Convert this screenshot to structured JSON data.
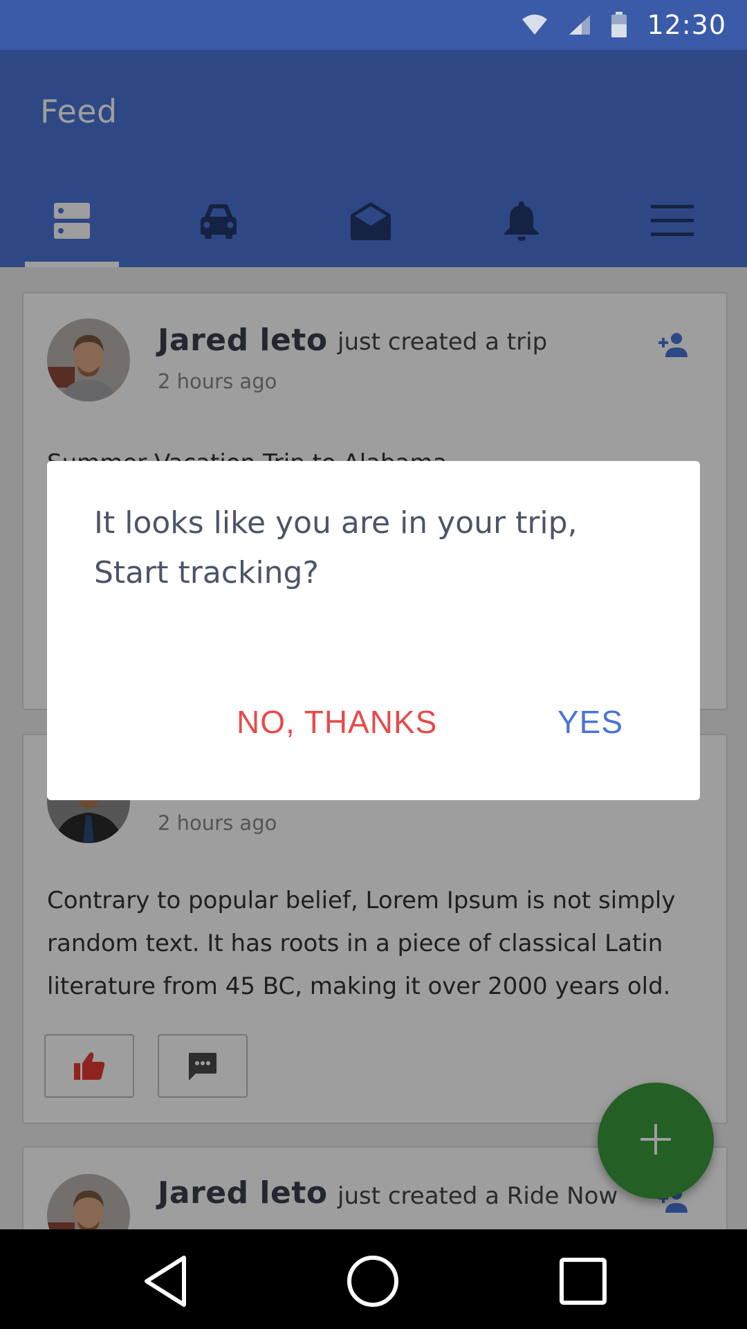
{
  "status_bar": {
    "time": "12:30"
  },
  "app_bar": {
    "title": "Feed",
    "tabs": [
      {
        "name": "feed",
        "icon": "list-icon",
        "active": true
      },
      {
        "name": "rides",
        "icon": "car-icon",
        "active": false
      },
      {
        "name": "messages",
        "icon": "open-mail-icon",
        "active": false
      },
      {
        "name": "notifications",
        "icon": "bell-icon",
        "active": false
      },
      {
        "name": "menu",
        "icon": "hamburger-menu-icon",
        "active": false
      }
    ]
  },
  "feed": {
    "posts": [
      {
        "author": "Jared leto",
        "action": "just created a trip",
        "time": "2 hours ago",
        "text": "Summer Vacation Trip to Alabama"
      },
      {
        "author": "",
        "action": "",
        "time": "2 hours ago",
        "text": "Contrary to popular belief, Lorem Ipsum is not simply random text. It has roots in a piece of classical Latin literature from 45 BC, making it over 2000 years old."
      },
      {
        "author": "Jared leto",
        "action": "just created a Ride Now",
        "time": "",
        "text": ""
      }
    ]
  },
  "dialog": {
    "message": "It looks like you are in your trip, Start tracking?",
    "negative_label": "NO, THANKS",
    "positive_label": "YES"
  },
  "colors": {
    "primary": "#4a74d6",
    "status_bar": "#3a5ba8",
    "negative": "#e84a4a",
    "fab": "#3a9a3c",
    "like": "#e53935"
  }
}
